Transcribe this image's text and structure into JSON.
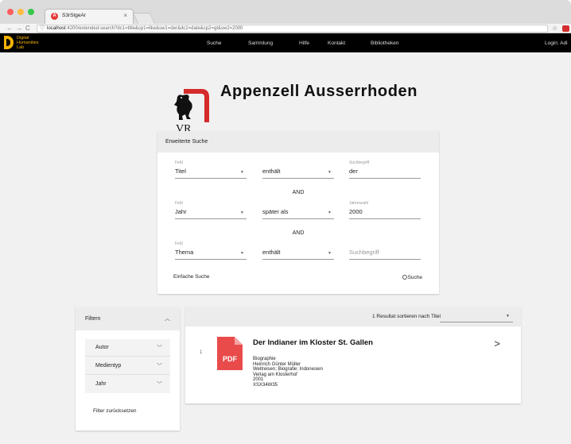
{
  "browser": {
    "tab_title": "S3rStgeAr",
    "tab_favicon": "A",
    "tab_close": "×",
    "url_host": "localhost",
    "url_path": ":4200/extended-search?dc1=title&cp1=like&sw1=der&dc2=date&cp2=gt&sw2=2000",
    "info_icon": "ⓘ",
    "back_icon": "←",
    "forward_icon": "→",
    "reload_icon": "C",
    "star_icon": "☆"
  },
  "header": {
    "logo_lines": [
      "Digital",
      "Humanities",
      "Lab"
    ],
    "nav": [
      "Suche",
      "Sammlung",
      "Hilfe",
      "Kontakt",
      "Bibliotheken"
    ],
    "login": "Login: Adi"
  },
  "brand": {
    "title": "Appenzell Ausserrhoden",
    "emblem_letters": "VR"
  },
  "search": {
    "card_title": "Erweiterte Suche",
    "rows": [
      {
        "field_label": "Feld",
        "field_value": "Titel",
        "operator": "enthält",
        "term_label": "Suchbegriff",
        "term_value": "der",
        "term_placeholder": ""
      },
      {
        "field_label": "Feld",
        "field_value": "Jahr",
        "operator": "später als",
        "term_label": "Jahreszahl",
        "term_value": "2000",
        "term_placeholder": ""
      },
      {
        "field_label": "Feld",
        "field_value": "Thema",
        "operator": "enthält",
        "term_label": "",
        "term_value": "",
        "term_placeholder": "Suchbegriff"
      }
    ],
    "connectors": [
      "AND",
      "AND"
    ],
    "simple_search": "Einfache Suche",
    "search_button": "Suche",
    "dropdown_arrow": "▼"
  },
  "filters": {
    "title": "Filtern",
    "collapse_chevron": "︿",
    "items": [
      {
        "label": "Autor"
      },
      {
        "label": "Medientyp"
      },
      {
        "label": "Jahr"
      }
    ],
    "item_chevron": "﹀",
    "reset": "Filter zurücksetzen"
  },
  "results": {
    "count_text": "1 Resultat sortieren nach Titel",
    "items": [
      {
        "index": "1",
        "type_badge": "PDF",
        "title": "Der Indianer im Kloster St. Gallen",
        "meta": [
          "Biographie",
          "Heinrich Günter Müller",
          "Weltreisen; Biografie; Indonesien",
          "Verlag am Klosterhof",
          "2001",
          "XSX34W35"
        ],
        "open_chevron": ">"
      }
    ]
  },
  "colors": {
    "header_bg": "#000000",
    "logo": "#f5b200",
    "pdf_red": "#e94b4b",
    "page_bg": "#f1f1f1"
  }
}
